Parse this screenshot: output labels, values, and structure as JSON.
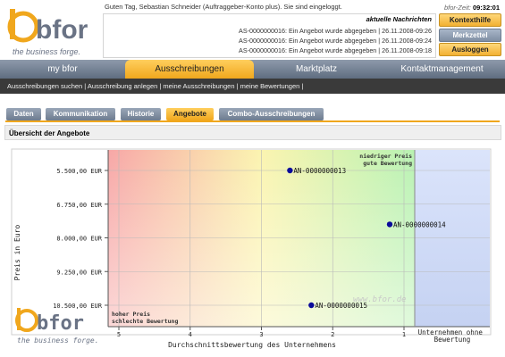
{
  "header": {
    "logo_text": "bfor",
    "logo_slogan": "the business forge.",
    "welcome": "Guten Tag, Sebastian Schneider (Auftraggeber-Konto plus). Sie sind eingeloggt.",
    "news_title": "aktuelle Nachrichten",
    "news": [
      "AS-0000000016: Ein Angebot wurde abgegeben  |  26.11.2008-09:26",
      "AS-0000000016: Ein Angebot wurde abgegeben  |  26.11.2008-09:24",
      "AS-0000000016: Ein Angebot wurde abgegeben  |  26.11.2008-09:18"
    ],
    "clock_label": "bfor-Zeit:",
    "clock_value": "09:32:01",
    "btn_help": "Kontexthilfe",
    "btn_memo": "Merkzettel",
    "btn_logout": "Ausloggen"
  },
  "nav": {
    "items": [
      "my bfor",
      "Ausschreibungen",
      "Marktplatz",
      "Kontaktmanagement"
    ],
    "active_index": 1
  },
  "subnav": "Ausschreibungen suchen | Ausschreibung anlegen | meine Ausschreibungen | meine Bewertungen |",
  "tabs": {
    "items": [
      "Daten",
      "Kommunikation",
      "Historie",
      "Angebote",
      "Combo-Ausschreibungen"
    ],
    "active_index": 3
  },
  "section_title": "Übersicht der Angebote",
  "colors": {
    "accent": "#f0a71d",
    "nav": "#6d7b8e",
    "point": "#0a0a9a"
  },
  "chart_data": {
    "type": "scatter",
    "ylabel": "Preis in Euro",
    "xlabel": "Durchschnittsbewertung des Unternehmens",
    "y_tick_labels": [
      "5.500,00 EUR",
      "6.750,00 EUR",
      "8.000,00 EUR",
      "9.250,00 EUR",
      "10.500,00 EUR"
    ],
    "y_ticks": [
      5500,
      6750,
      8000,
      9250,
      10500
    ],
    "ylim": [
      5500,
      10500
    ],
    "y_inverted": true,
    "x_tick_labels": [
      "5",
      "4",
      "3",
      "2",
      "1"
    ],
    "x_ticks": [
      5,
      4,
      3,
      2,
      1
    ],
    "x_inverted": true,
    "xlim": [
      5,
      1
    ],
    "no_rating_label": "Unternehmen ohne Bewertung",
    "annotation_top_right": [
      "niedriger Preis",
      "gute Bewertung"
    ],
    "annotation_bottom_left": [
      "hoher Preis",
      "schlechte Bewertung"
    ],
    "watermark": "www.bfor.de",
    "points": [
      {
        "label": "AN-0000000013",
        "x": 2.6,
        "y": 5500,
        "no_rating": false
      },
      {
        "label": "AN-0000000014",
        "x": null,
        "y": 7500,
        "no_rating": true
      },
      {
        "label": "AN-0000000015",
        "x": 2.3,
        "y": 10500,
        "no_rating": false
      }
    ]
  }
}
